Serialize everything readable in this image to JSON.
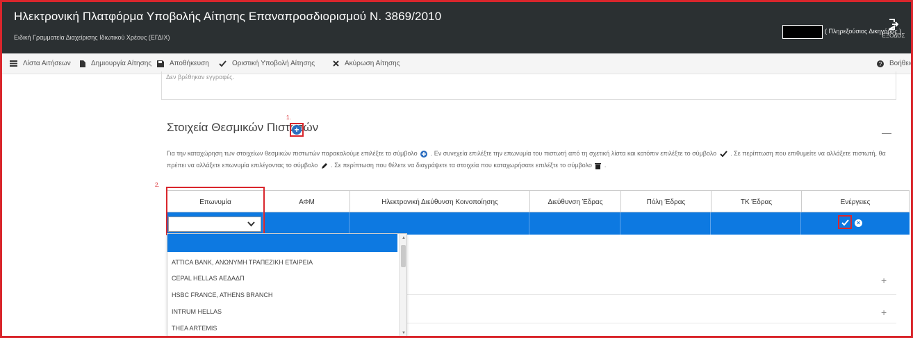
{
  "header": {
    "title": "Ηλεκτρονική Πλατφόρμα Υποβολής Αίτησης Επαναπροσδιορισμού Ν. 3869/2010",
    "subtitle": "Ειδική Γραμματεία Διαχείρισης Ιδιωτικού Χρέους (ΕΓΔΙΧ)",
    "user_role": "( Πληρεξούσιος Δικηγόρος )",
    "logout_label": "ΕΞΟΔΟΣ"
  },
  "menu": {
    "items": [
      {
        "label": "Λίστα Αιτήσεων",
        "icon": "list-icon"
      },
      {
        "label": "Δημιουργία Αίτησης",
        "icon": "file-icon"
      },
      {
        "label": "Αποθήκευση",
        "icon": "save-icon"
      },
      {
        "label": "Οριστική Υποβολή Αίτησης",
        "icon": "check-icon"
      },
      {
        "label": "Ακύρωση Αίτησης",
        "icon": "close-icon"
      }
    ],
    "help_label": "Βοήθεια"
  },
  "section": {
    "no_results": "Δεν βρέθηκαν εγγραφές.",
    "title": "Στοιχεία Θεσμικών Πιστωτών",
    "annotation_1": "1.",
    "annotation_2": "2.",
    "help_part1": "Για την καταχώρηση των στοιχείων θεσμικών πιστωτών παρακαλούμε επιλέξτε το σύμβολο",
    "help_part2": ". Εν συνεχεία επιλέξτε την επωνυμία του πιστωτή από τη σχετική λίστα και κατόπιν επιλέξτε το σύμβολο",
    "help_part3": ". Σε περίπτωση που επιθυμείτε να αλλάξετε πιστωτή, θα πρέπει να αλλάξετε επωνυμία επιλέγοντας το σύμβολο",
    "help_part4": ". Σε περίπτωση που θέλετε να διαγράψετε τα στοιχεία που καταχωρήσατε επιλέξτε το σύμβολο",
    "help_part5": "."
  },
  "table": {
    "columns": [
      "Επωνυμία",
      "ΑΦΜ",
      "Ηλεκτρονική Διεύθυνση Κοινοποίησης",
      "Διεύθυνση Έδρας",
      "Πόλη Έδρας",
      "ΤΚ Έδρας",
      "Ενέργειες"
    ]
  },
  "dropdown": {
    "options": [
      "ATTICA BANK, ΑΝΩΝΥΜΗ ΤΡΑΠΕΖΙΚΗ ΕΤΑΙΡΕΙΑ",
      "CEPAL HELLAS ΑΕΔΑΔΠ",
      "HSBC FRANCE, ATHENS BRANCH",
      "INTRUM HELLAS",
      "THEA ARTEMIS"
    ]
  },
  "colors": {
    "topbar": "#2b3032",
    "accent_blue": "#0d79e1",
    "annotation_red": "#d9262c"
  }
}
